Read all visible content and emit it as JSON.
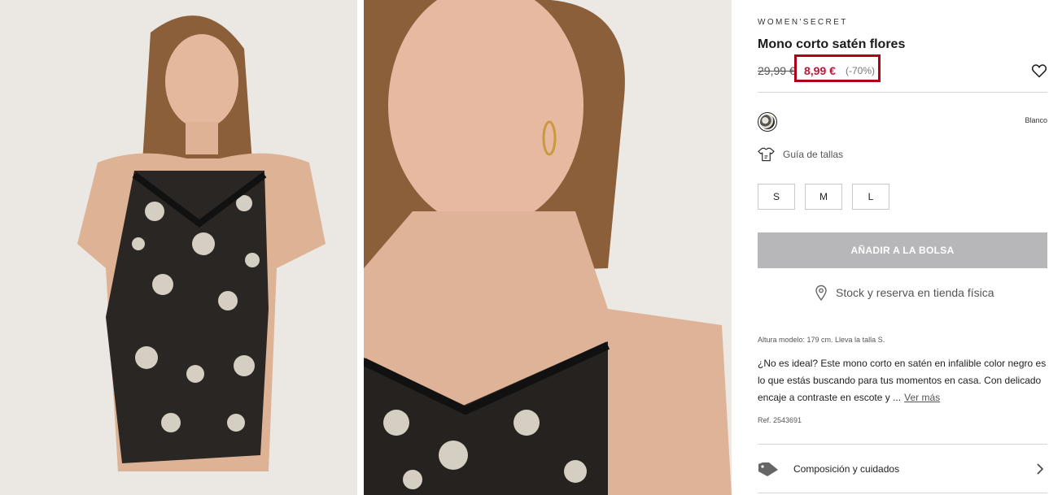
{
  "product": {
    "brand": "WOMEN'SECRET",
    "title": "Mono corto satén flores",
    "old_price": "29,99 €",
    "sale_price": "8,99 €",
    "discount": "(-70%)",
    "color_name": "Blanco",
    "size_guide_label": "Guía de tallas",
    "sizes": [
      "S",
      "M",
      "L"
    ],
    "add_to_bag_label": "AÑADIR A LA BOLSA",
    "stock_label": "Stock y reserva en tienda física",
    "model_info": "Altura modelo: 179 cm.  Lleva la talla S.",
    "description": "¿No es ideal? Este mono corto en satén en infalible color negro es lo que estás buscando para tus momentos en casa. Con delicado encaje a contraste en escote y ...",
    "more_label": "Ver más",
    "ref": "Ref. 2543691",
    "composition_label": "Composición y cuidados"
  },
  "icons": {
    "favorite": "heart-outline-icon",
    "swatch": "floral-print-swatch",
    "size_guide": "tshirt-ruler-icon",
    "stock": "location-pin-icon",
    "composition": "label-tag-icon",
    "chevron": "chevron-right-icon"
  },
  "colors": {
    "sale_price": "#c0153a",
    "highlight_border": "#b00016",
    "add_to_bag_bg": "#b7b7ba"
  }
}
